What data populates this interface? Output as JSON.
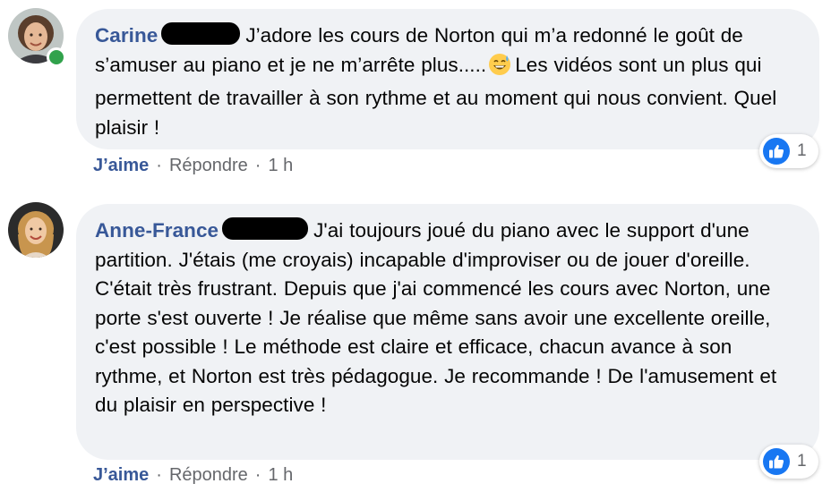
{
  "colors": {
    "bubble_bg": "#f0f2f5",
    "author": "#385898",
    "link": "#385898",
    "meta": "#65676b",
    "online": "#31a24c",
    "like_blue": "#1877f2"
  },
  "comments": [
    {
      "author": "Carine",
      "emoji": "grinning-sweat-emoji",
      "text_before_emoji": "J’adore les cours de Norton qui m’a redonné le goût de s’amuser au piano et je ne m’arrête plus.....",
      "text_after_emoji": "Les vidéos sont un plus qui permettent de travailler à son rythme et au moment qui nous convient. Quel plaisir !",
      "reaction_icon": "thumbs-up-icon",
      "reaction_count": "1",
      "like_label": "J’aime",
      "reply_label": "Répondre",
      "separator": "·",
      "time": "1 h"
    },
    {
      "author": "Anne-France",
      "text": "J'ai toujours joué du piano avec le support d'une partition. J'étais (me croyais) incapable d'improviser ou de jouer d'oreille. C'était très frustrant. Depuis que j'ai commencé les cours avec Norton, une porte s'est ouverte ! Je réalise que même sans avoir une excellente oreille, c'est possible ! Le méthode est claire et efficace, chacun avance à son rythme, et Norton est très pédagogue. Je recommande ! De l'amusement et du plaisir en perspective !",
      "reaction_icon": "thumbs-up-icon",
      "reaction_count": "1",
      "like_label": "J’aime",
      "reply_label": "Répondre",
      "separator": "·",
      "time": "1 h"
    }
  ]
}
